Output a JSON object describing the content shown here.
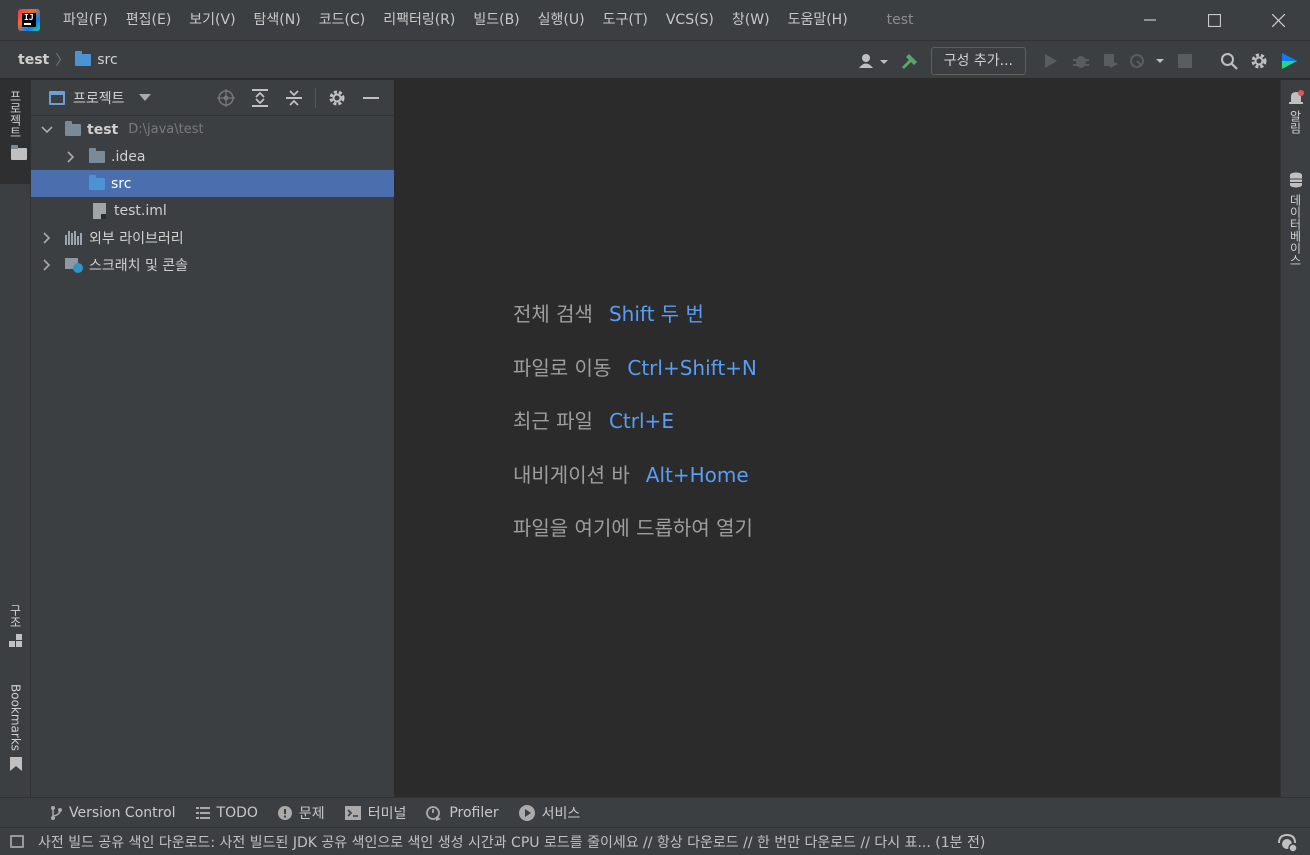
{
  "window": {
    "title": "test",
    "menu": [
      "파일(F)",
      "편집(E)",
      "보기(V)",
      "탐색(N)",
      "코드(C)",
      "리팩터링(R)",
      "빌드(B)",
      "실행(U)",
      "도구(T)",
      "VCS(S)",
      "창(W)",
      "도움말(H)"
    ]
  },
  "breadcrumb": {
    "root": "test",
    "child": "src"
  },
  "toolbar": {
    "config_label": "구성 추가..."
  },
  "left_stripe": {
    "project": "프로젝트",
    "structure": "구조",
    "bookmarks": "Bookmarks"
  },
  "right_stripe": {
    "notifications": "알림",
    "database": "데이터베이스"
  },
  "project_panel": {
    "title": "프로젝트",
    "tree": {
      "root_name": "test",
      "root_path": "D:\\java\\test",
      "idea": ".idea",
      "src": "src",
      "iml": "test.iml",
      "libs": "외부 라이브러리",
      "scratches": "스크래치 및 콘솔"
    }
  },
  "editor_hints": [
    {
      "label": "전체 검색",
      "key": "Shift 두 번"
    },
    {
      "label": "파일로 이동",
      "key": "Ctrl+Shift+N"
    },
    {
      "label": "최근 파일",
      "key": "Ctrl+E"
    },
    {
      "label": "내비게이션 바",
      "key": "Alt+Home"
    },
    {
      "label": "파일을 여기에 드롭하여 열기",
      "key": ""
    }
  ],
  "bottom_tools": [
    "Version Control",
    "TODO",
    "문제",
    "터미널",
    "Profiler",
    "서비스"
  ],
  "status": "사전 빌드 공유 색인 다운로드: 사전 빌드된 JDK 공유 색인으로 색인 생성 시간과 CPU 로드를 줄이세요 // 항상 다운로드 // 한 번만 다운로드 // 다시 표... (1분 전)",
  "colors": {
    "accent": "#589df6",
    "selection": "#4b6eaf",
    "background": "#2b2b2b",
    "panel": "#3c3f41"
  }
}
